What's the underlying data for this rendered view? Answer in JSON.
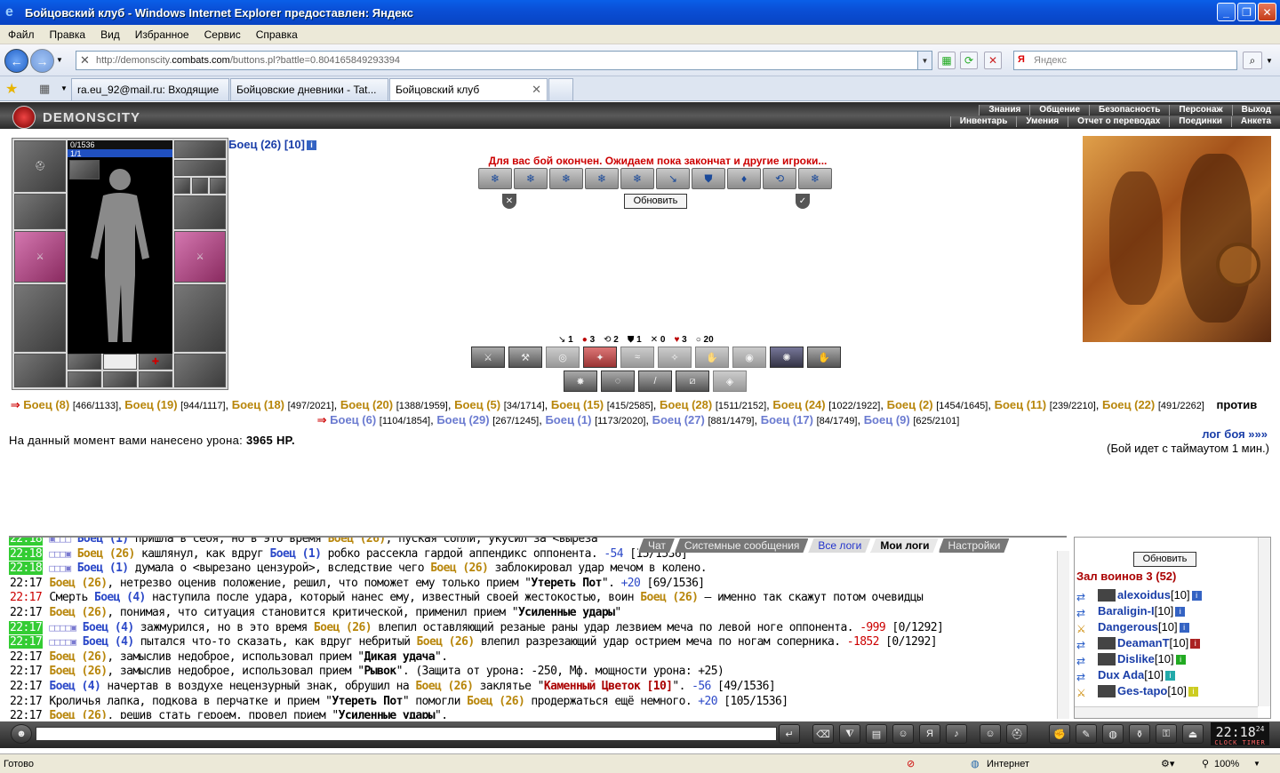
{
  "window": {
    "title": "Бойцовский клуб - Windows Internet Explorer предоставлен: Яндекс"
  },
  "menu": [
    "Файл",
    "Правка",
    "Вид",
    "Избранное",
    "Сервис",
    "Справка"
  ],
  "address": {
    "prefix": "http://demonscity.",
    "domain": "combats.com",
    "suffix": "/buttons.pl?battle=0.804165849293394"
  },
  "search": {
    "placeholder": "Яндекс"
  },
  "tabs": [
    {
      "label": "ra.eu_92@mail.ru: Входящие"
    },
    {
      "label": "Бойцовские дневники - Tat..."
    },
    {
      "label": "Бойцовский клуб"
    }
  ],
  "topnav": {
    "logo": "DEMONSCITY",
    "row1": [
      "Знания",
      "Общение",
      "Безопасность",
      "Персонаж",
      "Выход"
    ],
    "row2": [
      "Инвентарь",
      "Умения",
      "Отчет о переводах",
      "Поединки",
      "Анкета"
    ]
  },
  "character": {
    "hp": "0/1536",
    "mp": "1/1",
    "name": "Боец (26) [10]"
  },
  "battle": {
    "finished": "Для вас бой окончен. Ожидаем пока закончат и другие игроки...",
    "refresh": "Обновить",
    "counters": [
      "1",
      "3",
      "2",
      "1",
      "0",
      "3",
      "20"
    ],
    "damage_label": "На данный момент вами нанесено урона:",
    "damage_value": "3965 HP.",
    "log_link": "лог боя »»»",
    "timeout_text": "(Бой идет с таймаутом 1 мин.)",
    "versus": "против"
  },
  "team1": [
    {
      "name": "Боец (8)",
      "hp": "[466/1133]"
    },
    {
      "name": "Боец (19)",
      "hp": "[944/1117]"
    },
    {
      "name": "Боец (18)",
      "hp": "[497/2021]"
    },
    {
      "name": "Боец (20)",
      "hp": "[1388/1959]"
    },
    {
      "name": "Боец (5)",
      "hp": "[34/1714]"
    },
    {
      "name": "Боец (15)",
      "hp": "[415/2585]"
    },
    {
      "name": "Боец (28)",
      "hp": "[1511/2152]"
    },
    {
      "name": "Боец (24)",
      "hp": "[1022/1922]"
    },
    {
      "name": "Боец (2)",
      "hp": "[1454/1645]"
    },
    {
      "name": "Боец (11)",
      "hp": "[239/2210]"
    },
    {
      "name": "Боец (22)",
      "hp": "[491/2262]"
    }
  ],
  "team2": [
    {
      "name": "Боец (6)",
      "hp": "[1104/1854]"
    },
    {
      "name": "Боец (29)",
      "hp": "[267/1245]"
    },
    {
      "name": "Боец (1)",
      "hp": "[1173/2020]"
    },
    {
      "name": "Боец (27)",
      "hp": "[881/1479]"
    },
    {
      "name": "Боец (17)",
      "hp": "[84/1749]"
    },
    {
      "name": "Боец (9)",
      "hp": "[625/2101]"
    }
  ],
  "chat_tabs": [
    "Чат",
    "Системные сообщения",
    "Все логи",
    "Мои логи",
    "Настройки"
  ],
  "hall": {
    "refresh": "Обновить",
    "title": "Зал воинов 3 (52)",
    "players": [
      {
        "name": "alexoidus",
        "level": "[10]"
      },
      {
        "name": "Baraligin-I",
        "level": "[10]"
      },
      {
        "name": "Dangerous",
        "level": "[10]"
      },
      {
        "name": "DeamanT",
        "level": "[10]"
      },
      {
        "name": "Dislike",
        "level": "[10]"
      },
      {
        "name": "Dux Ada",
        "level": "[10]"
      },
      {
        "name": "Ges-tapo",
        "level": "[10]"
      }
    ]
  },
  "clock": {
    "time": "22:18",
    "sec": "24",
    "label": "CLOCK TIMER"
  },
  "status": {
    "left": "Готово",
    "zone": "Интернет",
    "zoom": "100%"
  }
}
